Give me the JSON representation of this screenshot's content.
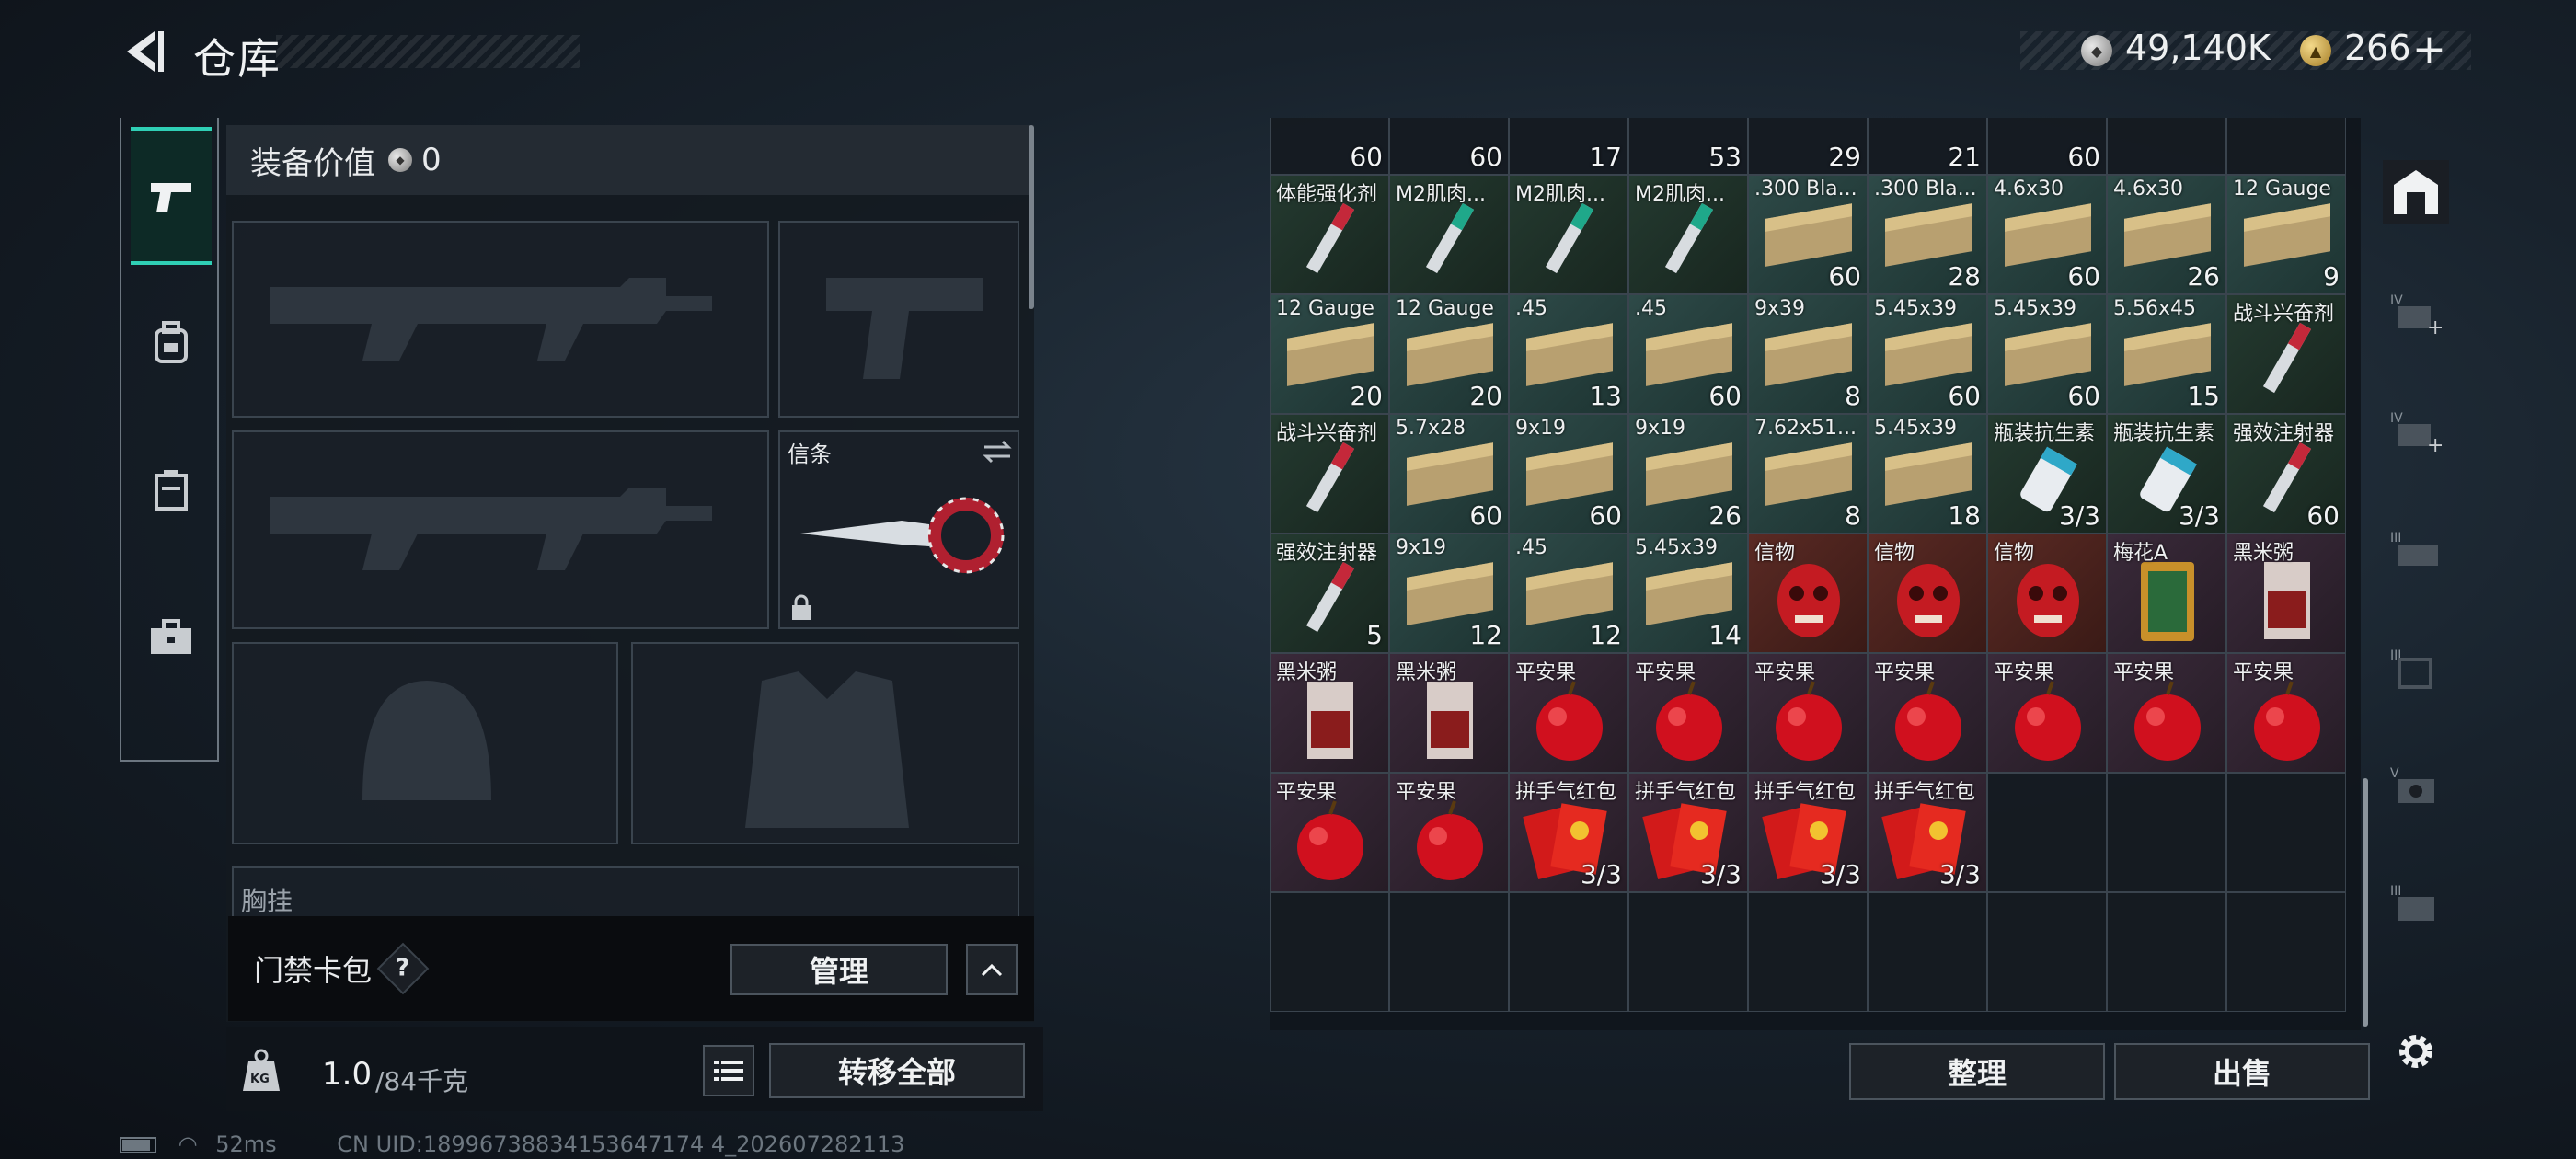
{
  "header": {
    "title": "仓库",
    "silver_amount": "49,140K",
    "gold_amount": "266"
  },
  "equipment": {
    "value_label": "装备价值",
    "value": "0",
    "knife_label": "信条",
    "chest_label": "胸挂",
    "card_pack_label": "门禁卡包",
    "help": "?",
    "manage_label": "管理",
    "weight_current": "1.0",
    "weight_max": "/84千克",
    "weight_icon_text": "KG",
    "transfer_all_label": "转移全部"
  },
  "status": {
    "ping": "52ms",
    "uid": "CN UID:18996738834153647174 4_202607282113"
  },
  "inventory": {
    "rows": [
      [
        {
          "n": "",
          "c": "60"
        },
        {
          "n": "",
          "c": "60"
        },
        {
          "n": "",
          "c": "17"
        },
        {
          "n": "",
          "c": "53"
        },
        {
          "n": "",
          "c": "29"
        },
        {
          "n": "",
          "c": "21"
        },
        {
          "n": "",
          "c": "60"
        },
        {
          "n": "",
          "c": ""
        },
        {
          "n": "",
          "c": ""
        }
      ],
      [
        {
          "n": "体能强化剂",
          "c": ""
        },
        {
          "n": "M2肌肉...",
          "c": ""
        },
        {
          "n": "M2肌肉...",
          "c": ""
        },
        {
          "n": "M2肌肉...",
          "c": ""
        },
        {
          "n": ".300 Bla...",
          "c": "60"
        },
        {
          "n": ".300 Bla...",
          "c": "28"
        },
        {
          "n": "4.6x30",
          "c": "60"
        },
        {
          "n": "4.6x30",
          "c": "26"
        },
        {
          "n": "12 Gauge",
          "c": "9"
        }
      ],
      [
        {
          "n": "12 Gauge",
          "c": "20"
        },
        {
          "n": "12 Gauge",
          "c": "20"
        },
        {
          "n": ".45",
          "c": "13"
        },
        {
          "n": ".45",
          "c": "60"
        },
        {
          "n": "9x39",
          "c": "8"
        },
        {
          "n": "5.45x39",
          "c": "60"
        },
        {
          "n": "5.45x39",
          "c": "60"
        },
        {
          "n": "5.56x45",
          "c": "15"
        },
        {
          "n": "战斗兴奋剂",
          "c": ""
        }
      ],
      [
        {
          "n": "战斗兴奋剂",
          "c": ""
        },
        {
          "n": "5.7x28",
          "c": "60"
        },
        {
          "n": "9x19",
          "c": "60"
        },
        {
          "n": "9x19",
          "c": "26"
        },
        {
          "n": "7.62x51...",
          "c": "8"
        },
        {
          "n": "5.45x39",
          "c": "18"
        },
        {
          "n": "瓶装抗生素",
          "c": "3/3"
        },
        {
          "n": "瓶装抗生素",
          "c": "3/3"
        },
        {
          "n": "强效注射器",
          "c": "60"
        }
      ],
      [
        {
          "n": "强效注射器",
          "c": "5"
        },
        {
          "n": "9x19",
          "c": "12"
        },
        {
          "n": ".45",
          "c": "12"
        },
        {
          "n": "5.45x39",
          "c": "14"
        },
        {
          "n": "信物",
          "c": ""
        },
        {
          "n": "信物",
          "c": ""
        },
        {
          "n": "信物",
          "c": ""
        },
        {
          "n": "梅花A",
          "c": ""
        },
        {
          "n": "黑米粥",
          "c": ""
        }
      ],
      [
        {
          "n": "黑米粥",
          "c": ""
        },
        {
          "n": "黑米粥",
          "c": ""
        },
        {
          "n": "平安果",
          "c": ""
        },
        {
          "n": "平安果",
          "c": ""
        },
        {
          "n": "平安果",
          "c": ""
        },
        {
          "n": "平安果",
          "c": ""
        },
        {
          "n": "平安果",
          "c": ""
        },
        {
          "n": "平安果",
          "c": ""
        },
        {
          "n": "平安果",
          "c": ""
        }
      ],
      [
        {
          "n": "平安果",
          "c": ""
        },
        {
          "n": "平安果",
          "c": ""
        },
        {
          "n": "拼手气红包",
          "c": "3/3"
        },
        {
          "n": "拼手气红包",
          "c": "3/3"
        },
        {
          "n": "拼手气红包",
          "c": "3/3"
        },
        {
          "n": "拼手气红包",
          "c": "3/3"
        },
        {
          "n": "",
          "c": ""
        },
        {
          "n": "",
          "c": ""
        },
        {
          "n": "",
          "c": ""
        }
      ]
    ],
    "sort_label": "整理",
    "sell_label": "出售"
  }
}
